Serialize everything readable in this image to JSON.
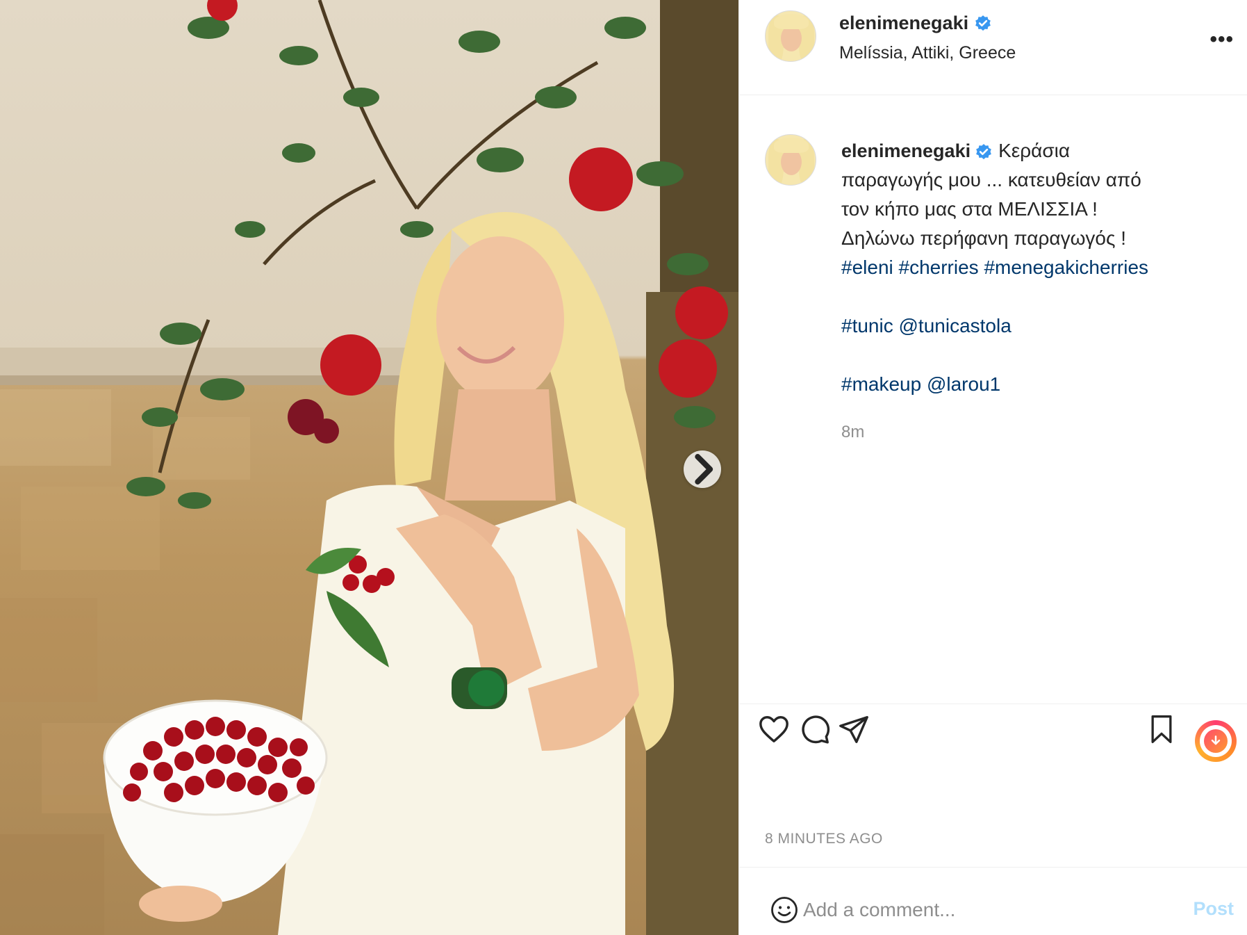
{
  "post": {
    "author": "elenimenegaki",
    "verified": true,
    "location": "Melíssia, Attiki, Greece",
    "more_label": "•••",
    "image_description_icon": "photo",
    "next_icon": "chevron-right-icon"
  },
  "caption": {
    "username": "elenimenegaki",
    "lines": [
      "Κεράσια",
      "παραγωγής μου ... κατευθείαν από",
      "τον κήπο μας στα ΜΕΛΙΣΣΙΑ !",
      "Δηλώνω περήφανη παραγωγός !",
      "#eleni #cherries #menegakicherries",
      "",
      "#tunic @tunicastola",
      "",
      "#makeup @larou1"
    ],
    "age": "8m"
  },
  "actions": {
    "like_icon": "heart-icon",
    "comment_icon": "comment-icon",
    "share_icon": "paper-plane-icon",
    "save_icon": "bookmark-icon",
    "download_icon": "download-icon"
  },
  "timestamp": "8 MINUTES AGO",
  "comment_box": {
    "placeholder": "Add a comment...",
    "post_label": "Post",
    "emoji_icon": "smiley-icon"
  },
  "colors": {
    "verified_blue": "#3897f0",
    "link_blue": "#00376b",
    "muted_gray": "#8e8e8e",
    "post_disabled": "#b2dffc"
  }
}
